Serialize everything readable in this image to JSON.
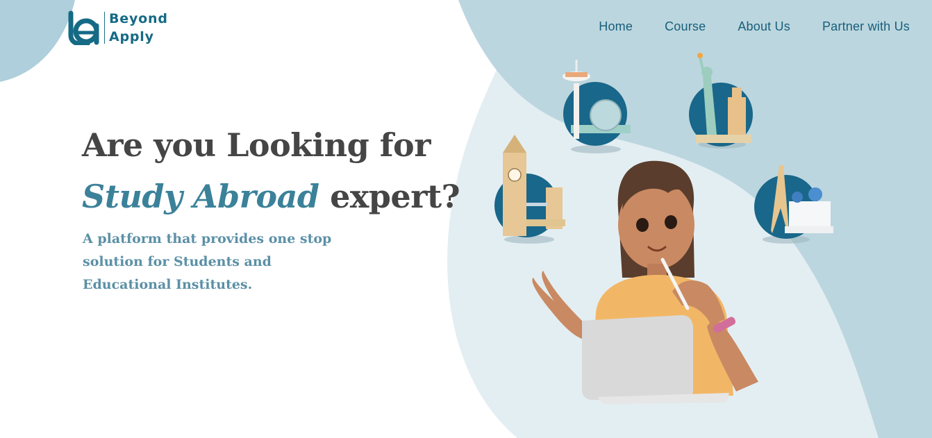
{
  "brand": {
    "line1": "Beyond",
    "line2": "Apply",
    "color": "#156a85"
  },
  "nav": {
    "items": [
      "Home",
      "Course",
      "About Us",
      "Partner with Us"
    ]
  },
  "hero": {
    "title_line1": "Are you Looking for",
    "title_accent": "Study Abroad",
    "title_rest": " expert?",
    "subtitle": "A platform that provides one stop solution for Students and Educational Institutes."
  },
  "colors": {
    "blob_light": "#e6f0f3",
    "blob_mid": "#c9dfe6",
    "blob_dark": "#aecfdb",
    "title": "#454545",
    "accent": "#3b8199",
    "subtitle": "#5b90a6"
  },
  "illustration": {
    "icons": [
      "space-needle-icon",
      "statue-of-liberty-icon",
      "big-ben-icon",
      "eiffel-tower-icon",
      "student-with-laptop-icon"
    ]
  }
}
